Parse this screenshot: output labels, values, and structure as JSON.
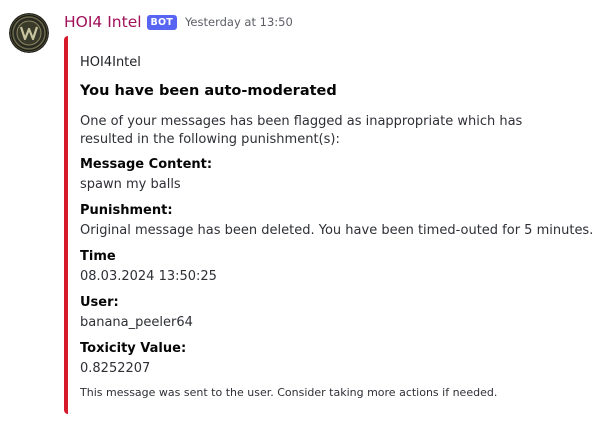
{
  "message": {
    "author_name": "HOI4 Intel",
    "author_color": "#a0115a",
    "bot_tag": "BOT",
    "bot_tag_color": "#5865f2",
    "timestamp": "Yesterday at 13:50",
    "avatar_icon": "hoi4-logo-icon"
  },
  "embed": {
    "accent_color": "#d61a2b",
    "author": "HOI4Intel",
    "title": "You have been auto-moderated",
    "description": "One of your messages has been flagged as inappropriate which has resulted in the following punishment(s):",
    "fields": [
      {
        "name": "Message Content:",
        "value": "spawn my balls"
      },
      {
        "name": "Punishment:",
        "value": "Original message has been deleted. You have been timed-outed for 5 minutes."
      },
      {
        "name": "Time",
        "value": "08.03.2024 13:50:25"
      },
      {
        "name": "User:",
        "value": "banana_peeler64"
      },
      {
        "name": "Toxicity Value:",
        "value": "0.8252207"
      }
    ],
    "footer": "This message was sent to the user. Consider taking more actions if needed."
  }
}
